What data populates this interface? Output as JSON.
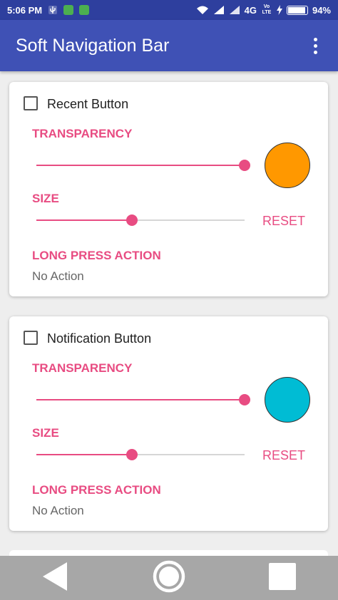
{
  "status_bar": {
    "time": "5:06 PM",
    "network": "4G",
    "volte": "Vo LTE",
    "battery_percent": "94%",
    "battery_level": 0.94,
    "notification_icons": [
      "usb-icon",
      "android-icon",
      "android-icon"
    ],
    "status_icons": [
      "wifi-icon",
      "signal-icon",
      "signal-icon",
      "charging-icon",
      "battery-icon"
    ]
  },
  "app_bar": {
    "title": "Soft Navigation Bar",
    "menu_icon": "overflow-menu-icon"
  },
  "cards": [
    {
      "checkbox_label": "Recent Button",
      "checked": false,
      "transparency_label": "TRANSPARENCY",
      "transparency_value": 1.0,
      "size_label": "SIZE",
      "size_value": 0.46,
      "color": "#ff9800",
      "reset_label": "RESET",
      "long_press_label": "LONG PRESS ACTION",
      "long_press_value": "No Action"
    },
    {
      "checkbox_label": "Notification Button",
      "checked": false,
      "transparency_label": "TRANSPARENCY",
      "transparency_value": 1.0,
      "size_label": "SIZE",
      "size_value": 0.46,
      "color": "#00bcd4",
      "reset_label": "RESET",
      "long_press_label": "LONG PRESS ACTION",
      "long_press_value": "No Action"
    }
  ],
  "nav_bar": {
    "buttons": [
      "back-icon",
      "home-icon",
      "recents-icon"
    ]
  },
  "colors": {
    "primary": "#3f51b5",
    "status_bar": "#2e3f9e",
    "accent": "#e84c82",
    "nav_bar": "#a7a7a7"
  }
}
